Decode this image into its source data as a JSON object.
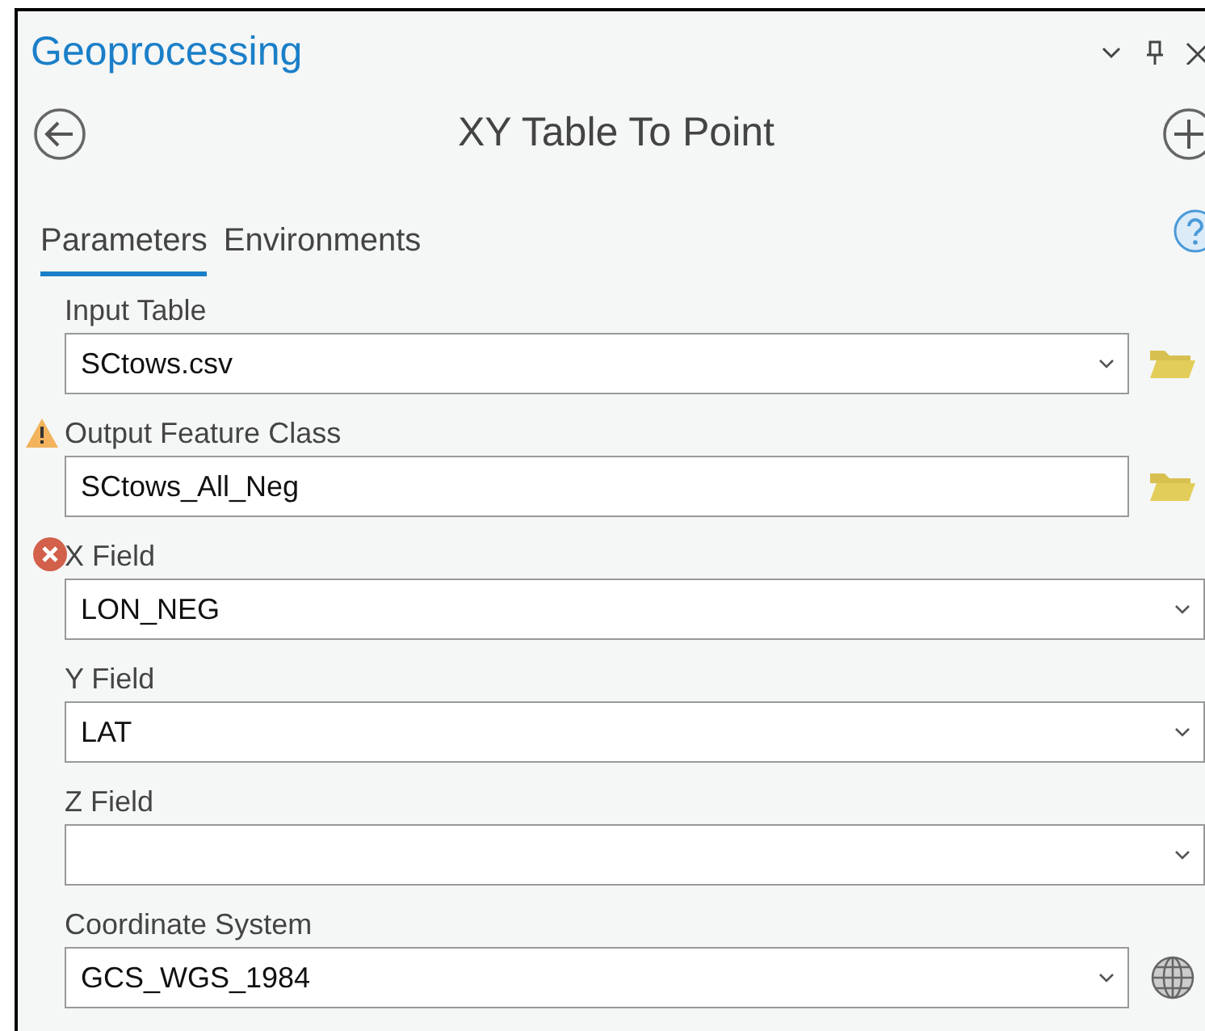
{
  "pane": {
    "title": "Geoprocessing"
  },
  "tool": {
    "title": "XY Table To Point"
  },
  "tabs": [
    {
      "label": "Parameters",
      "selected": true
    },
    {
      "label": "Environments",
      "selected": false
    }
  ],
  "parameters": [
    {
      "label": "Input Table",
      "value": "SCtows.csv",
      "warning": false,
      "error": false,
      "dropdown": true,
      "folder_button": true,
      "globe_button": false
    },
    {
      "label": "Output Feature Class",
      "value": "SCtows_All_Neg",
      "warning": true,
      "error": false,
      "dropdown": false,
      "folder_button": true,
      "globe_button": false
    },
    {
      "label": "X Field",
      "value": "LON_NEG",
      "warning": false,
      "error": true,
      "dropdown": true,
      "folder_button": false,
      "globe_button": false
    },
    {
      "label": "Y Field",
      "value": "LAT",
      "warning": false,
      "error": false,
      "dropdown": true,
      "folder_button": false,
      "globe_button": false
    },
    {
      "label": "Z Field",
      "warning": false,
      "error": false,
      "dropdown": true,
      "folder_button": false,
      "globe_button": false
    },
    {
      "label": "Coordinate System",
      "value": "GCS_WGS_1984",
      "warning": false,
      "error": false,
      "dropdown": true,
      "folder_button": false,
      "globe_button": true
    }
  ]
}
